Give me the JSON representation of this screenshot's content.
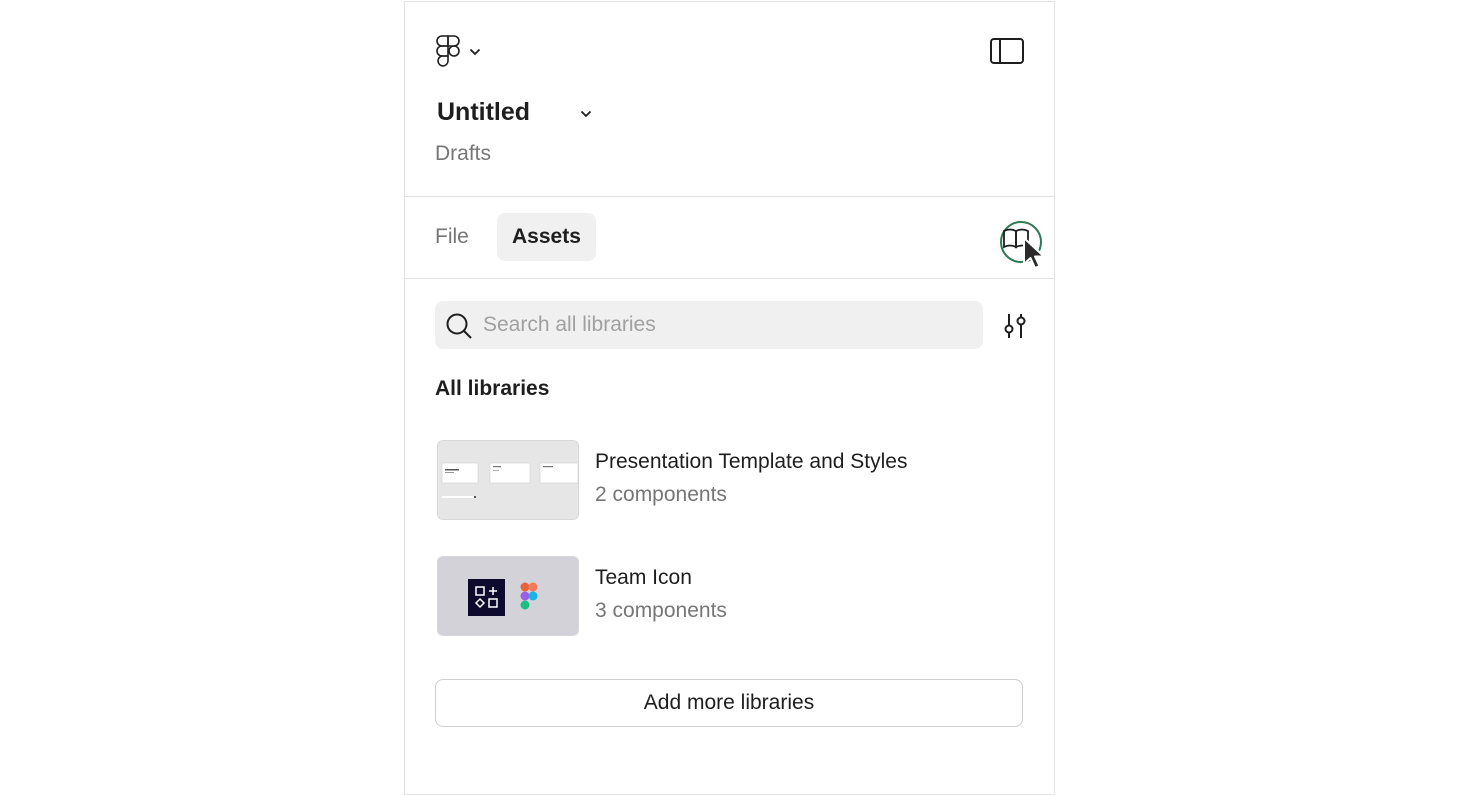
{
  "header": {
    "file_title": "Untitled",
    "location": "Drafts"
  },
  "tabs": [
    {
      "label": "File",
      "active": false
    },
    {
      "label": "Assets",
      "active": true
    }
  ],
  "search": {
    "placeholder": "Search all libraries"
  },
  "libraries": {
    "section_title": "All libraries",
    "items": [
      {
        "name": "Presentation Template and Styles",
        "count": "2 components"
      },
      {
        "name": "Team Icon",
        "count": "3 components"
      }
    ],
    "add_label": "Add more libraries"
  },
  "icons": {
    "logo": "figma-logo-icon",
    "sidebar_toggle": "sidebar-toggle-icon",
    "libraries": "book-icon",
    "search": "search-icon",
    "filter": "filter-sliders-icon",
    "cursor": "mouse-pointer-icon"
  },
  "colors": {
    "highlight_ring": "#2d7a55",
    "active_tab_bg": "#f0f0f0",
    "team_icon_bg": "#0d0a2e"
  }
}
